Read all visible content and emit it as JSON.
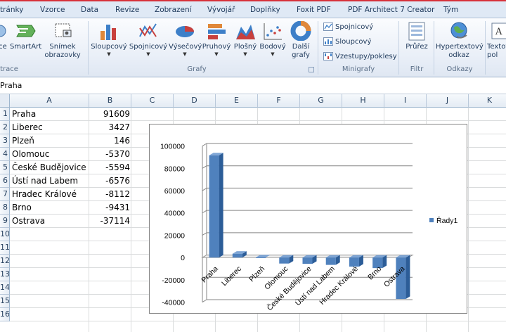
{
  "tabs": [
    "tránky",
    "Vzorce",
    "Data",
    "Revize",
    "Zobrazení",
    "Vývojář",
    "Doplňky",
    "Foxit PDF",
    "PDF Architect 7 Creator",
    "Tým"
  ],
  "ribbon": {
    "buttons": {
      "clipart_partial": "ce",
      "smartart": "SmartArt",
      "snimek_line1": "Snímek",
      "snimek_line2": "obrazovky",
      "sloupcovy": "Sloupcový",
      "spojnicovy": "Spojnicový",
      "vysecovy": "Výsečový",
      "pruhovy": "Pruhový",
      "plosny": "Plošný",
      "bodovy": "Bodový",
      "dalsi_line1": "Další",
      "dalsi_line2": "grafy",
      "spark_line": "Spojnicový",
      "spark_column": "Sloupcový",
      "spark_winloss": "Vzestupy/poklesy",
      "prurez": "Průřez",
      "hyperlink_line1": "Hypertextový",
      "hyperlink_line2": "odkaz",
      "textbox_line1": "Textové",
      "textbox_line2": "pol"
    },
    "groups": {
      "ilustrace": "trace",
      "grafy": "Grafy",
      "minigrafy": "Minigrafy",
      "filtr": "Filtr",
      "odkazy": "Odkazy"
    }
  },
  "formula_bar": {
    "content": "Praha"
  },
  "columns": [
    "A",
    "B",
    "C",
    "D",
    "E",
    "F",
    "G",
    "H",
    "I",
    "J",
    "K"
  ],
  "rows": [
    "1",
    "2",
    "3",
    "4",
    "5",
    "6",
    "7",
    "8",
    "9",
    "10",
    "11",
    "12",
    "13",
    "14",
    "15",
    "16"
  ],
  "cells": [
    {
      "name": "Praha",
      "value": "91609"
    },
    {
      "name": "Liberec",
      "value": "3427"
    },
    {
      "name": "Plzeň",
      "value": "146"
    },
    {
      "name": "Olomouc",
      "value": "-5370"
    },
    {
      "name": "České Budějovice",
      "value": "-5594"
    },
    {
      "name": "Ústí nad Labem",
      "value": "-6576"
    },
    {
      "name": "Hradec Králové",
      "value": "-8112"
    },
    {
      "name": "Brno",
      "value": "-9431"
    },
    {
      "name": "Ostrava",
      "value": "-37114"
    }
  ],
  "chart_data": {
    "type": "bar",
    "categories": [
      "Praha",
      "Liberec",
      "Plzeň",
      "Olomouc",
      "České Budějovice",
      "Ústí nad Labem",
      "Hradec Králové",
      "Brno",
      "Ostrava"
    ],
    "series": [
      {
        "name": "Řady1",
        "values": [
          91609,
          3427,
          146,
          -5370,
          -5594,
          -6576,
          -8112,
          -9431,
          -37114
        ],
        "color": "#4f81bd"
      }
    ],
    "yticks": [
      "100000",
      "80000",
      "60000",
      "40000",
      "20000",
      "0",
      "-20000",
      "-40000"
    ],
    "ylim": [
      -40000,
      100000
    ],
    "grid": true,
    "legend": "right",
    "style": "3d-column"
  }
}
